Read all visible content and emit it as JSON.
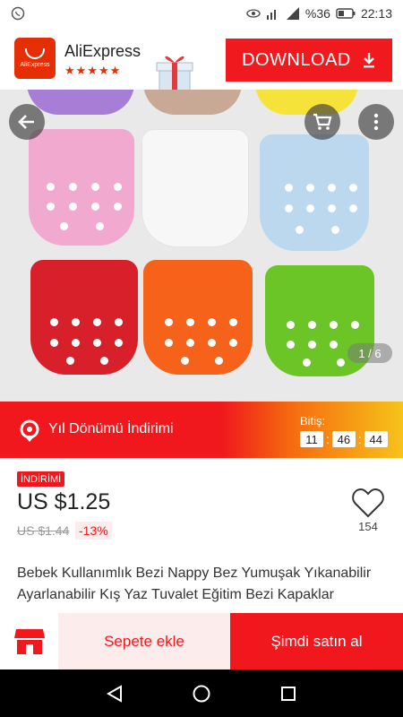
{
  "status_bar": {
    "signal_text": "%36",
    "time": "22:13"
  },
  "app_banner": {
    "logo_text": "AliExpress",
    "app_name": "AliExpress",
    "rating_stars": "★★★★★",
    "download_label": "DOWNLOAD"
  },
  "gallery": {
    "image_counter": "1 / 6"
  },
  "promo": {
    "title": "Yıl Dönümü İndirimi",
    "ends_label": "Bitiş:",
    "timer": [
      "11",
      "46",
      "44"
    ]
  },
  "product": {
    "sale_tag": "İNDİRİMİ",
    "price": "US $1.25",
    "old_price": "US $1.44",
    "discount": "-13%",
    "wishlist_count": "154",
    "title": "Bebek Kullanımlık Bezi Nappy Bez Yumuşak Yıkanabilir Ayarlanabilir Kış Yaz Tuvalet Eğitim Bezi Kapaklar"
  },
  "actions": {
    "add_to_cart": "Sepete ekle",
    "buy_now": "Şimdi satın al"
  },
  "colors": {
    "brand_red": "#f0181d",
    "promo_yellow": "#f7c31a",
    "pale_red": "#fdecec"
  }
}
